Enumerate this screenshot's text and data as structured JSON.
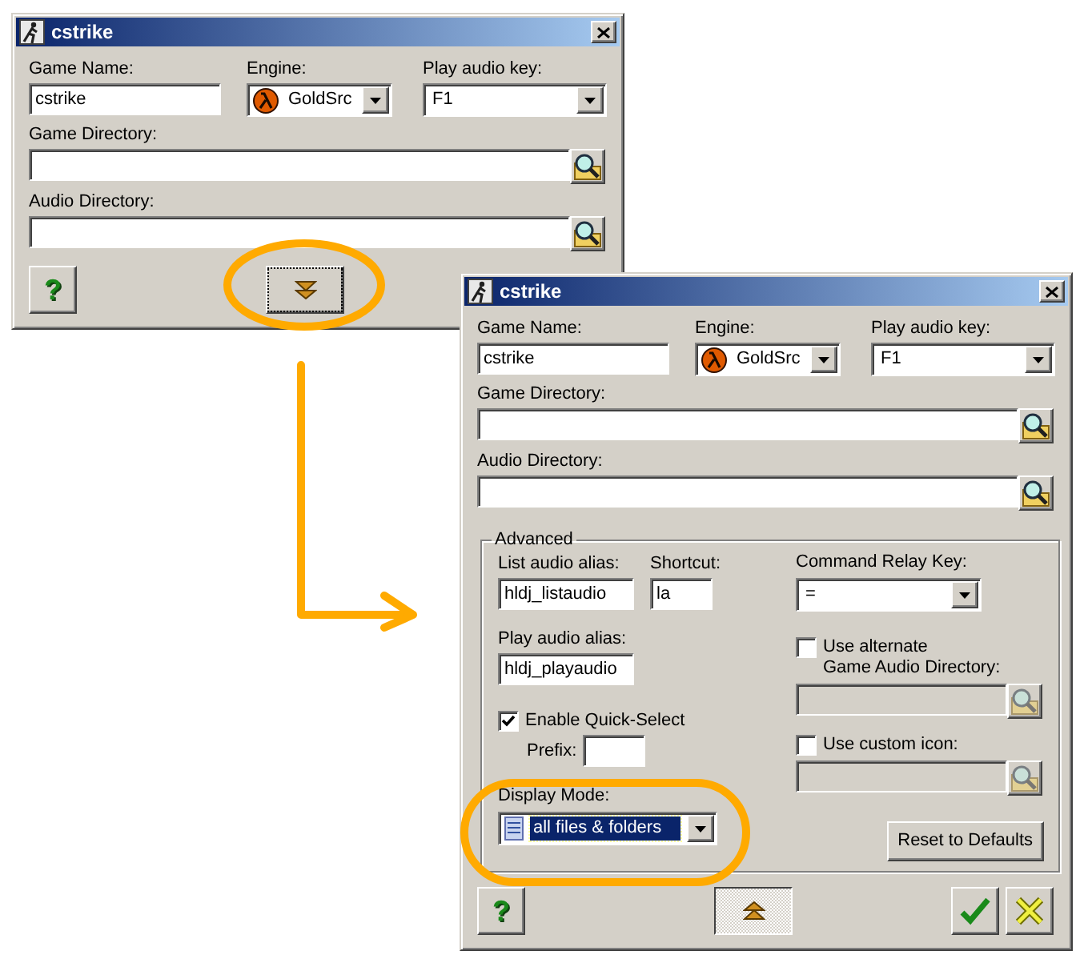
{
  "windows": [
    {
      "title": "cstrike",
      "game_name": {
        "label": "Game Name:",
        "value": "cstrike"
      },
      "engine": {
        "label": "Engine:",
        "value": "GoldSrc"
      },
      "play_audio_key": {
        "label": "Play audio key:",
        "value": "F1"
      },
      "game_directory": {
        "label": "Game Directory:"
      },
      "audio_directory": {
        "label": "Audio Directory:"
      },
      "help_button": "?",
      "expanded": false
    },
    {
      "title": "cstrike",
      "game_name": {
        "label": "Game Name:",
        "value": "cstrike"
      },
      "engine": {
        "label": "Engine:",
        "value": "GoldSrc"
      },
      "play_audio_key": {
        "label": "Play audio key:",
        "value": "F1"
      },
      "game_directory": {
        "label": "Game Directory:"
      },
      "audio_directory": {
        "label": "Audio Directory:"
      },
      "help_button": "?",
      "expanded": true,
      "advanced": {
        "title": "Advanced",
        "list_audio_alias": {
          "label": "List audio alias:",
          "value": "hldj_listaudio"
        },
        "shortcut": {
          "label": "Shortcut:",
          "value": "la"
        },
        "play_audio_alias": {
          "label": "Play audio alias:",
          "value": "hldj_playaudio"
        },
        "quick_select": {
          "label": "Enable Quick-Select",
          "checked": true
        },
        "prefix": {
          "label": "Prefix:"
        },
        "display_mode": {
          "label": "Display Mode:",
          "value": "all files & folders",
          "focused": true
        },
        "command_relay_key": {
          "label": "Command Relay Key:",
          "value": "="
        },
        "alternate_directory": {
          "label": "Use alternate\nGame Audio Directory:",
          "checked": false
        },
        "custom_icon": {
          "label": "Use custom icon:",
          "checked": false
        },
        "reset_button": "Reset to Defaults"
      }
    }
  ]
}
